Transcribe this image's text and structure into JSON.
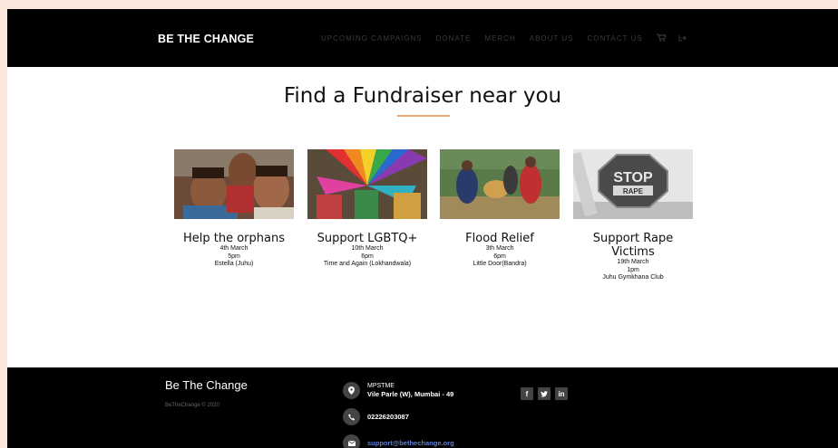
{
  "header": {
    "brand": "BE THE CHANGE",
    "menu": [
      "UPCOMING CAMPAIGNS",
      "DONATE",
      "MERCH",
      "ABOUT US",
      "CONTACT US"
    ],
    "cart_icon": "cart-icon",
    "logout_icon": "sign-out-icon"
  },
  "main": {
    "title": "Find a Fundraiser near you",
    "cards": [
      {
        "title": "Help the orphans",
        "date": "4th March",
        "time": "5pm",
        "venue": "Estella (Juhu)"
      },
      {
        "title": "Support LGBTQ+",
        "date": "10th March",
        "time": "6pm",
        "venue": "Time and Again (Lokhandwala)"
      },
      {
        "title": "Flood Relief",
        "date": "3th March",
        "time": "6pm",
        "venue": "Little Door(Bandra)"
      },
      {
        "title": "Support Rape Victims",
        "date": "19th March",
        "time": "1pm",
        "venue": "Juhu Gymkhana Club"
      }
    ],
    "stop_sign_text": "STOP",
    "stop_sign_sub": "RAPE"
  },
  "footer": {
    "brand": "Be The Change",
    "copyright": "BeTheChange © 2020",
    "address_line1": "MPSTME",
    "address_line2": "Vile Parle (W), Mumbai - 49",
    "phone": "02226203087",
    "email": "support@bethechange.org",
    "social": [
      "facebook-icon",
      "twitter-icon",
      "linkedin-icon"
    ]
  },
  "colors": {
    "page_bg": "#fbe7dc",
    "accent": "#e8a87c",
    "link": "#5b7fd8"
  }
}
